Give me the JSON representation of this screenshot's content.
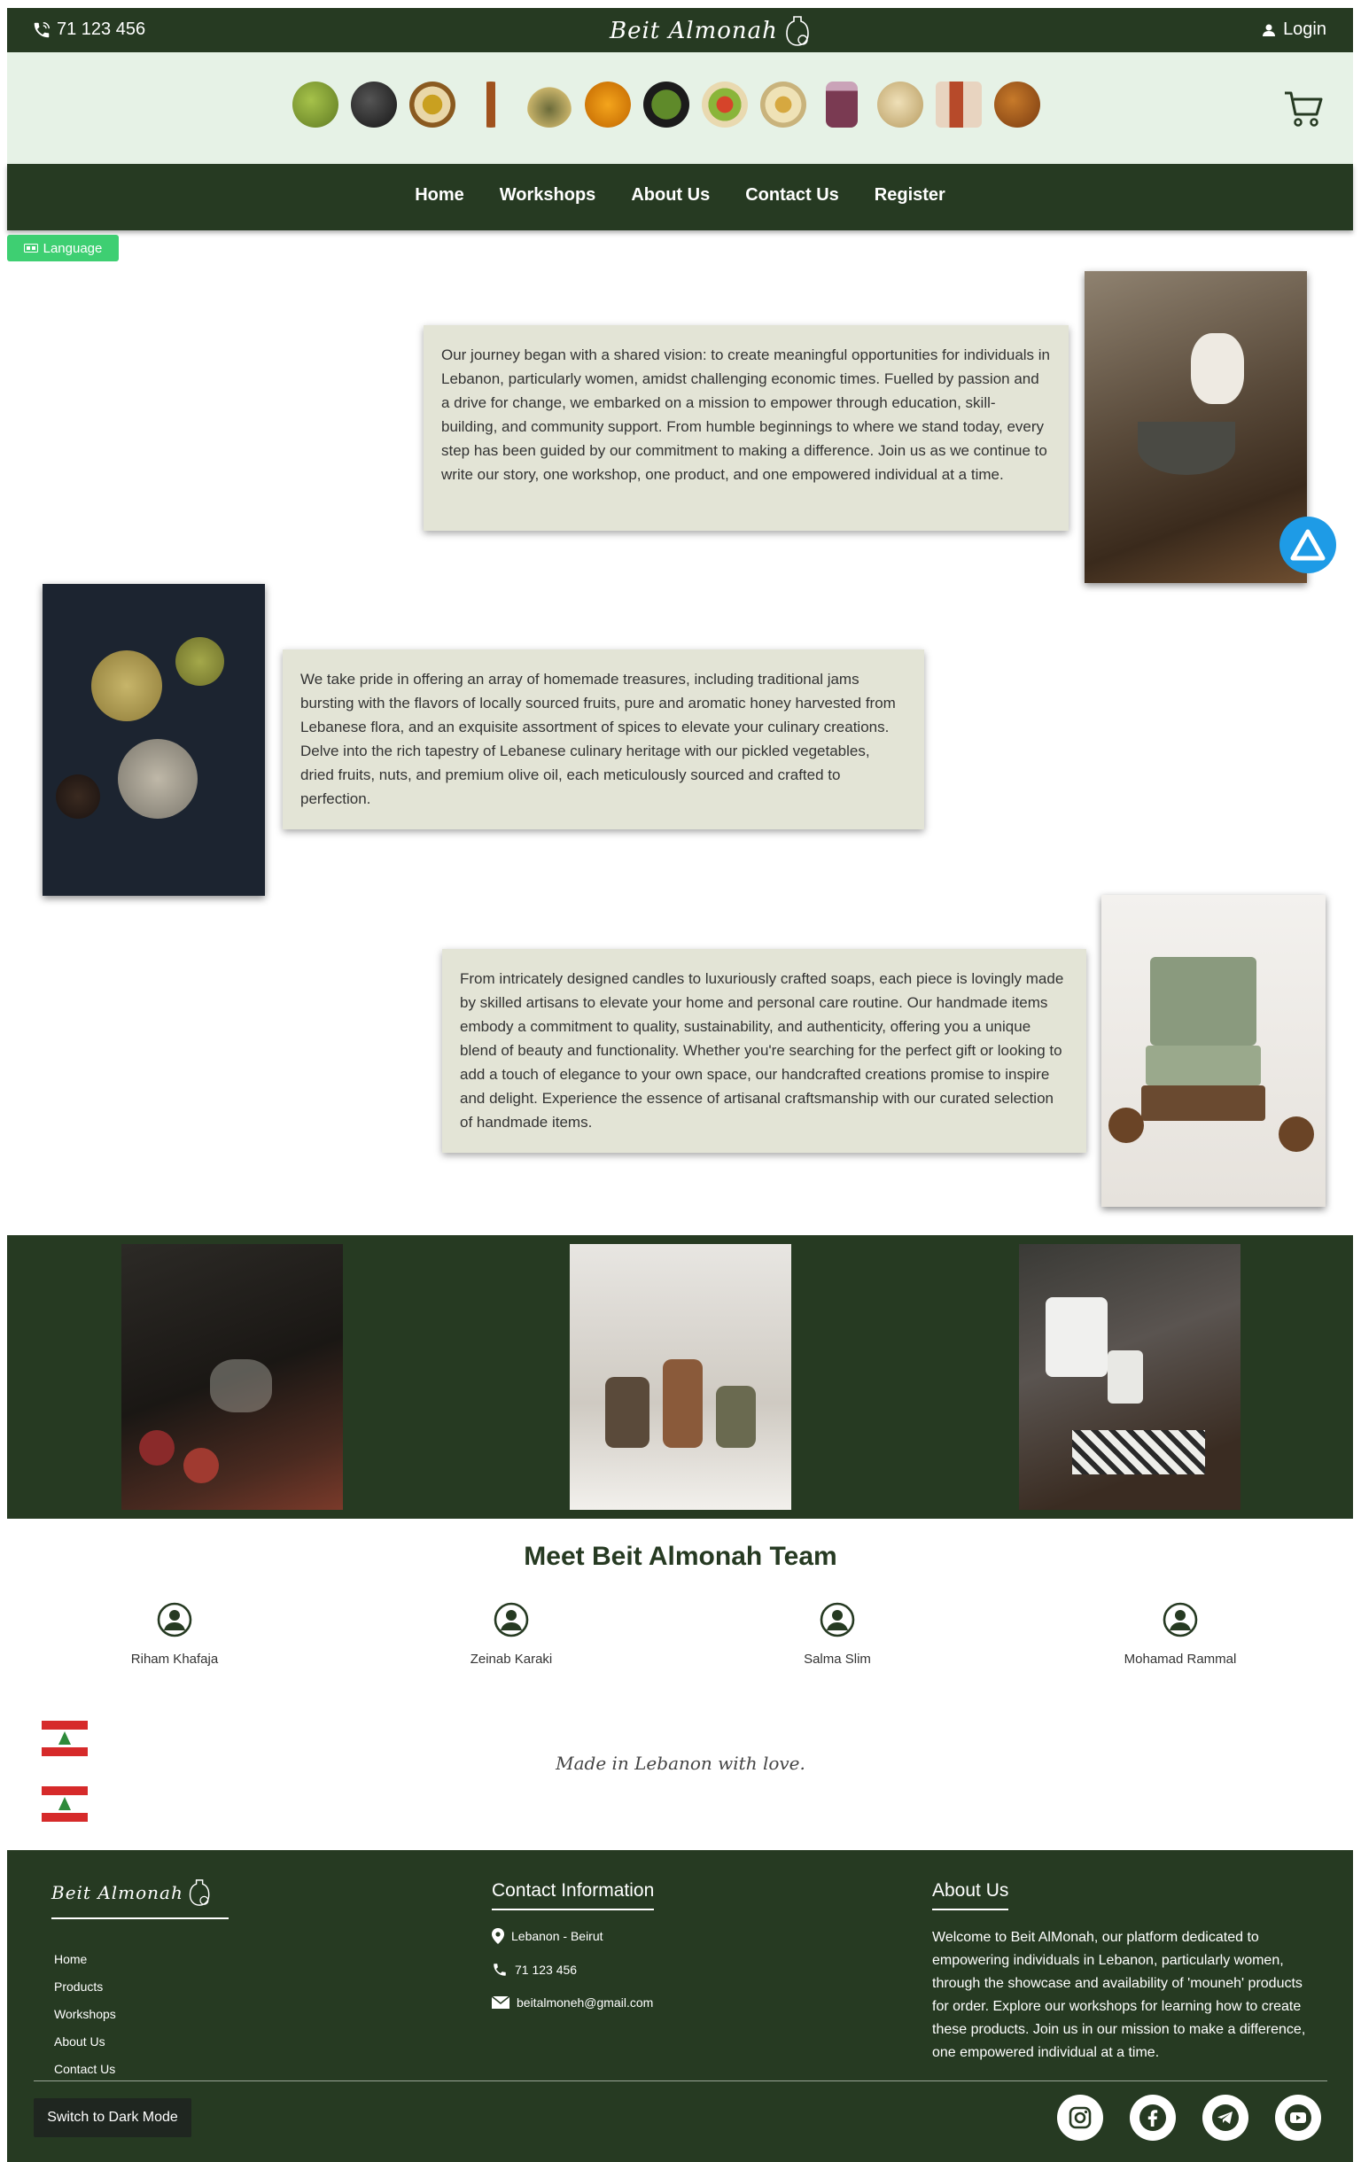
{
  "header": {
    "phone": "71 123 456",
    "brand": "Beit Almonah",
    "login_label": "Login"
  },
  "nav": {
    "items": [
      "Home",
      "Workshops",
      "About Us",
      "Contact Us",
      "Register"
    ]
  },
  "language_label": "Language",
  "story": {
    "card1": "Our journey began with a shared vision: to create meaningful opportunities for individuals in Lebanon, particularly women, amidst challenging economic times. Fuelled by passion and a drive for change, we embarked on a mission to empower through education, skill-building, and community support. From humble beginnings to where we stand today, every step has been guided by our commitment to making a difference. Join us as we continue to write our story, one workshop, one product, and one empowered individual at a time.",
    "card2": "We take pride in offering an array of homemade treasures, including traditional jams bursting with the flavors of locally sourced fruits, pure and aromatic honey harvested from Lebanese flora, and an exquisite assortment of spices to elevate your culinary creations. Delve into the rich tapestry of Lebanese culinary heritage with our pickled vegetables, dried fruits, nuts, and premium olive oil, each meticulously sourced and crafted to perfection.",
    "card3": "From intricately designed candles to luxuriously crafted soaps, each piece is lovingly made by skilled artisans to elevate your home and personal care routine. Our handmade items embody a commitment to quality, sustainability, and authenticity, offering you a unique blend of beauty and functionality. Whether you're searching for the perfect gift or looking to add a touch of elegance to your own space, our handcrafted creations promise to inspire and delight. Experience the essence of artisanal craftsmanship with our curated selection of handmade items."
  },
  "team": {
    "title": "Meet Beit Almonah Team",
    "members": [
      "Riham Khafaja",
      "Zeinab Karaki",
      "Salma Slim",
      "Mohamad Rammal"
    ]
  },
  "made_in": "Made in Lebanon with love.",
  "footer": {
    "brand": "Beit Almonah",
    "links": [
      "Home",
      "Products",
      "Workshops",
      "About Us",
      "Contact Us"
    ],
    "contact_title": "Contact Information",
    "location": "Lebanon - Beirut",
    "phone": "71 123 456",
    "email": "beitalmoneh@gmail.com",
    "about_title": "About Us",
    "about_text": "Welcome to Beit AlMonah, our platform dedicated to empowering individuals in Lebanon, particularly women, through the showcase and availability of 'mouneh' products for order. Explore our workshops for learning how to create these products. Join us in our mission to make a difference, one empowered individual at a time.",
    "dark_mode_label": "Switch to Dark Mode"
  },
  "colors": {
    "primary": "#263a22",
    "light_bg": "#e6f2e6",
    "card_bg": "#e3e4d6",
    "language_button": "#3ecf72",
    "float_button": "#1e9be6"
  }
}
